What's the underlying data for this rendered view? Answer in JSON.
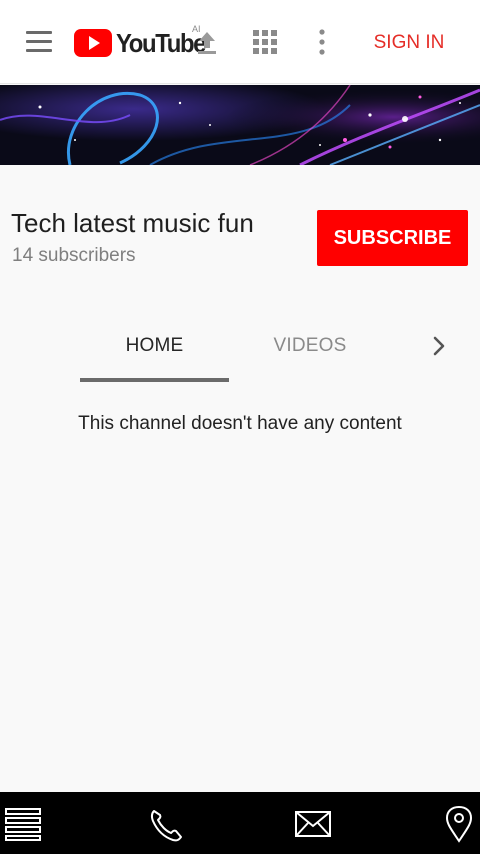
{
  "header": {
    "logo_text": "YouTube",
    "ai_badge": "AI",
    "sign_in_label": "SIGN IN",
    "icons": [
      "hamburger-menu-icon",
      "youtube-logo",
      "upload-icon",
      "apps-grid-icon",
      "more-vert-icon"
    ]
  },
  "channel": {
    "name": "Tech latest music fun",
    "subscribers": "14 subscribers",
    "subscribe_label": "SUBSCRIBE"
  },
  "tabs": {
    "items": [
      {
        "label": "HOME",
        "selected": true
      },
      {
        "label": "VIDEOS",
        "selected": false
      }
    ],
    "next_icon": "chevron-right-icon"
  },
  "content": {
    "empty_message": "This channel doesn't have any content"
  },
  "bottom_bar": {
    "icons": [
      "list-menu-icon",
      "phone-icon",
      "mail-icon",
      "location-pin-icon"
    ]
  },
  "colors": {
    "brand_red": "#ff0000",
    "sign_in_red": "#e52d27",
    "background": "#f9f9f9",
    "bottom_bar": "#000000"
  }
}
